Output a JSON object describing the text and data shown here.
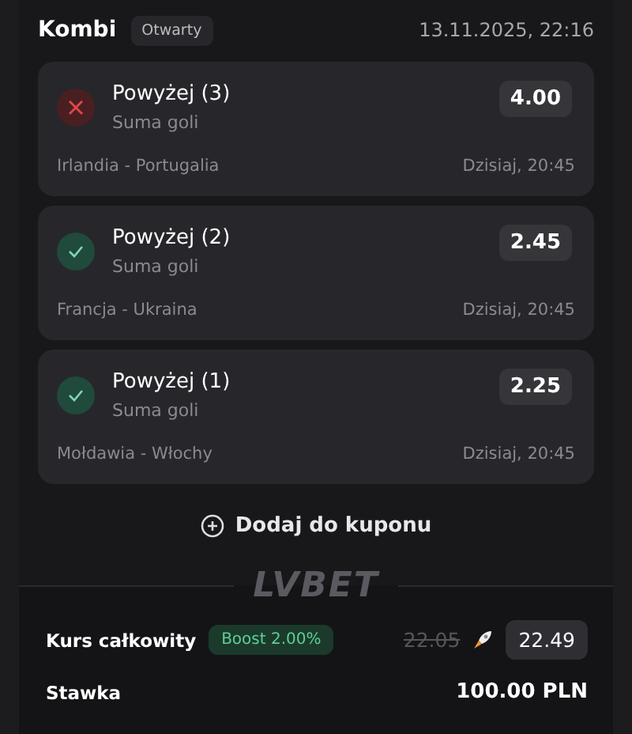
{
  "header": {
    "title": "Kombi",
    "badge": "Otwarty",
    "date": "13.11.2025, 22:16"
  },
  "selections": [
    {
      "won": false,
      "pick": "Powyżej (3)",
      "market": "Suma goli",
      "odds": "4.00",
      "match": "Irlandia - Portugalia",
      "time": "Dzisiaj, 20:45"
    },
    {
      "won": true,
      "pick": "Powyżej (2)",
      "market": "Suma goli",
      "odds": "2.45",
      "match": "Francja - Ukraina",
      "time": "Dzisiaj, 20:45"
    },
    {
      "won": true,
      "pick": "Powyżej (1)",
      "market": "Suma goli",
      "odds": "2.25",
      "match": "Mołdawia - Włochy",
      "time": "Dzisiaj, 20:45"
    }
  ],
  "add_button": "Dodaj do kuponu",
  "logo": "LVBET",
  "summary": {
    "total_label": "Kurs całkowity",
    "boost": "Boost 2.00%",
    "old_odds": "22.05",
    "odds": "22.49",
    "stake_label": "Stawka",
    "stake": "100.00 PLN"
  }
}
